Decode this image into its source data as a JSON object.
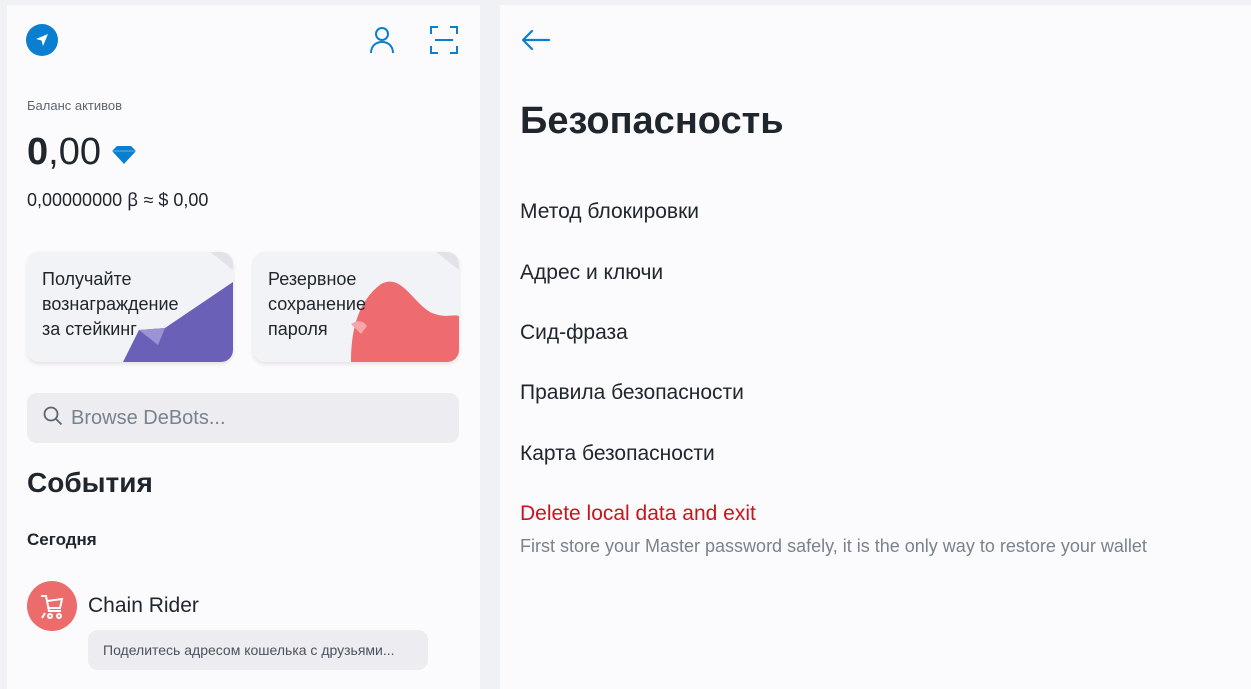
{
  "colors": {
    "accent": "#0a7fd0",
    "danger": "#c8151b",
    "card_purple": "#6a60b8",
    "card_red": "#ee6b6f"
  },
  "sidebar": {
    "logo_icon": "paper-plane-icon",
    "header_icons": [
      "user-icon",
      "scan-qr-icon"
    ],
    "balance": {
      "label": "Баланс активов",
      "integer_part": "0",
      "fraction_part": ",00",
      "currency_icon": "diamond-icon",
      "sub": "0,00000000 ꞵ ≈ $ 0,00"
    },
    "cards": [
      {
        "text": "Получайте\nвознаграждение\nза стейкинг"
      },
      {
        "text": "Резервное\nсохранение\nпароля"
      }
    ],
    "search": {
      "placeholder": "Browse DeBots..."
    },
    "events": {
      "title": "События",
      "group": "Сегодня",
      "items": [
        {
          "name": "Chain Rider",
          "message": "Поделитесь адресом кошелька с друзьями..."
        }
      ]
    }
  },
  "main": {
    "back_icon": "arrow-left-icon",
    "title": "Безопасность",
    "items": [
      {
        "label": "Метод блокировки"
      },
      {
        "label": "Адрес и ключи"
      },
      {
        "label": "Сид-фраза"
      },
      {
        "label": "Правила безопасности"
      },
      {
        "label": "Карта безопасности"
      }
    ],
    "danger_action": {
      "label": "Delete local data and exit",
      "note": "First store your Master password safely, it is the only way to restore your wallet"
    }
  }
}
